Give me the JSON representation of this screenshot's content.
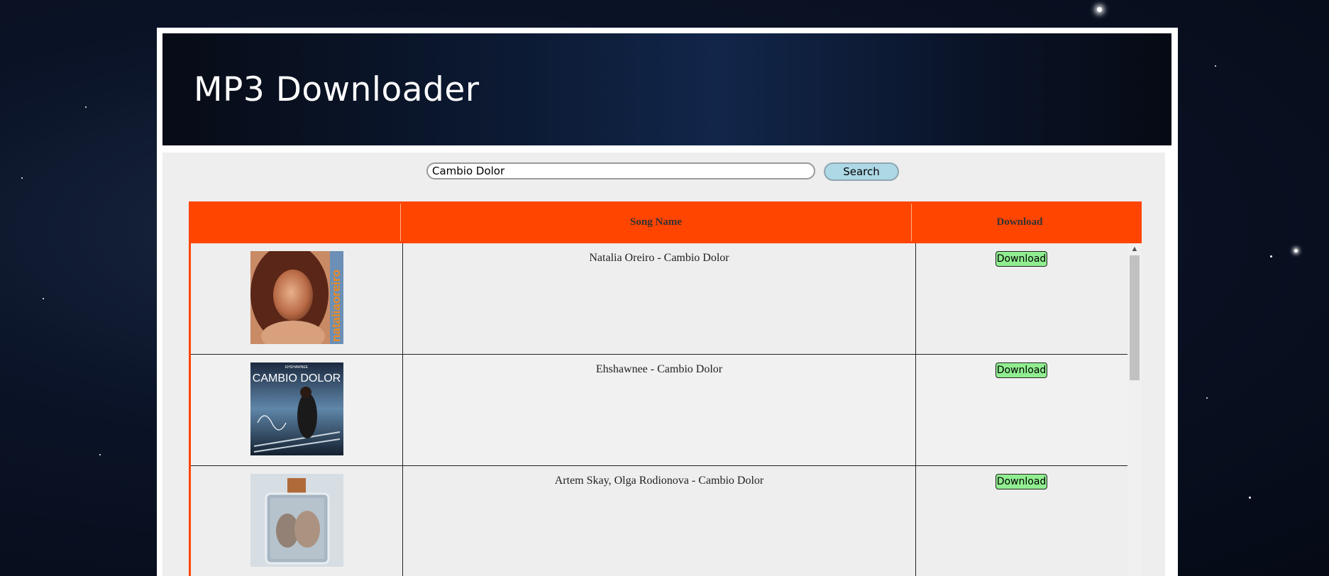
{
  "header": {
    "title": "MP3 Downloader"
  },
  "search": {
    "value": "Cambio Dolor",
    "button_label": "Search"
  },
  "table": {
    "columns": [
      "",
      "Song Name",
      "Download"
    ],
    "rows": [
      {
        "song": "Natalia Oreiro - Cambio Dolor",
        "download_label": "Download",
        "cover_text": "nataliaoreiro"
      },
      {
        "song": "Ehshawnee - Cambio Dolor",
        "download_label": "Download",
        "cover_text": "CAMBIO DOLOR",
        "cover_small": "EHSHAWNEE"
      },
      {
        "song": "Artem Skay, Olga Rodionova - Cambio Dolor",
        "download_label": "Download"
      }
    ]
  },
  "colors": {
    "header_bg": "#ff4500",
    "download_btn": "#90ee90",
    "search_btn": "#add8e6"
  },
  "icons": {
    "scroll_up": "chevron-up-icon"
  }
}
